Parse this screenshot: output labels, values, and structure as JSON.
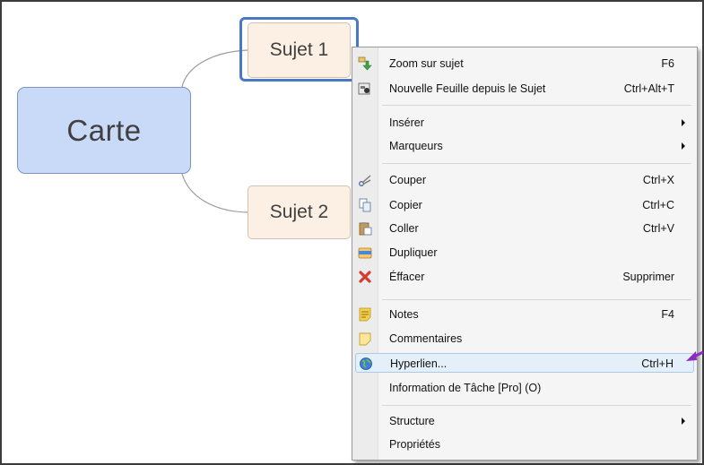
{
  "map": {
    "central_topic": "Carte",
    "subtopics": [
      "Sujet 1",
      "Sujet 2"
    ]
  },
  "context_menu": {
    "items": [
      {
        "label": "Zoom sur sujet",
        "shortcut": "F6",
        "icon": "zoom-topic-icon"
      },
      {
        "label": "Nouvelle Feuille depuis le Sujet",
        "shortcut": "Ctrl+Alt+T",
        "icon": "new-sheet-icon"
      },
      {
        "label": "Insérer",
        "shortcut": "",
        "submenu": true
      },
      {
        "label": "Marqueurs",
        "shortcut": "",
        "submenu": true
      },
      {
        "label": "Couper",
        "shortcut": "Ctrl+X",
        "icon": "scissors-icon"
      },
      {
        "label": "Copier",
        "shortcut": "Ctrl+C",
        "icon": "copy-icon"
      },
      {
        "label": "Coller",
        "shortcut": "Ctrl+V",
        "icon": "paste-icon"
      },
      {
        "label": "Dupliquer",
        "shortcut": "",
        "icon": "duplicate-icon"
      },
      {
        "label": "Éffacer",
        "shortcut": "Supprimer",
        "icon": "delete-icon"
      },
      {
        "label": "Notes",
        "shortcut": "F4",
        "icon": "notes-icon"
      },
      {
        "label": "Commentaires",
        "shortcut": "",
        "icon": "comment-icon"
      },
      {
        "label": "Hyperlien...",
        "shortcut": "Ctrl+H",
        "icon": "globe-icon",
        "highlighted": true
      },
      {
        "label": "Information de Tâche [Pro] (O)",
        "shortcut": ""
      },
      {
        "label": "Structure",
        "shortcut": "",
        "submenu": true
      },
      {
        "label": "Propriétés",
        "shortcut": ""
      }
    ]
  },
  "colors": {
    "central_fill": "#c9daf8",
    "subtopic_fill": "#fcefe3",
    "selection_border": "#4a79c4",
    "annotation_arrow": "#8e2bbf"
  }
}
